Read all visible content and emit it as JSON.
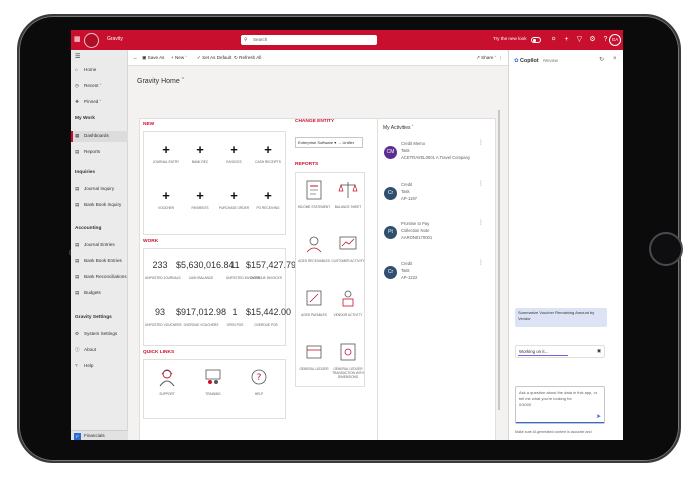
{
  "app": {
    "name": "Gravity",
    "search_placeholder": "Search",
    "try_new_look": "Try the new look",
    "avatar_initials": "GA",
    "brand_color": "#c8102e"
  },
  "topbar_icons": [
    "lightbulb-icon",
    "plus-icon",
    "filter-icon",
    "gear-icon",
    "help-icon"
  ],
  "sidebar": {
    "top_items": [
      {
        "label": "Home",
        "icon": "home-icon"
      },
      {
        "label": "Recent",
        "icon": "clock-icon"
      },
      {
        "label": "Pinned",
        "icon": "pin-icon"
      }
    ],
    "my_work": {
      "heading": "My Work",
      "items": [
        {
          "label": "Dashboards"
        },
        {
          "label": "Reports"
        }
      ]
    },
    "inquiries": {
      "heading": "Inquiries",
      "items": [
        {
          "label": "Journal Inquiry"
        },
        {
          "label": "Bank Book Inquiry"
        }
      ]
    },
    "accounting": {
      "heading": "Accounting",
      "items": [
        {
          "label": "Journal Entries"
        },
        {
          "label": "Bank Book Entries"
        },
        {
          "label": "Bank Reconciliations"
        },
        {
          "label": "Budgets"
        }
      ]
    },
    "gravity_settings": {
      "heading": "Gravity Settings",
      "items": [
        {
          "label": "System Settings"
        },
        {
          "label": "About"
        },
        {
          "label": "Help"
        }
      ]
    },
    "bottom": {
      "badge": "F",
      "label": "Financials"
    }
  },
  "commandbar": {
    "save_as": "Save As",
    "new": "New",
    "set_default": "Set As Default",
    "refresh": "Refresh All",
    "share": "Share"
  },
  "page": {
    "title": "Gravity Home"
  },
  "new_section": {
    "title": "NEW",
    "tiles": [
      "JOURNAL ENTRY",
      "BANK REC",
      "INVOICES",
      "CASH RECEIPTS",
      "VOUCHER",
      "PAYMENTS",
      "PURCHASE ORDER",
      "PO RECEIVING"
    ]
  },
  "work_section": {
    "title": "WORK",
    "metrics": [
      {
        "value": "233",
        "label": "UNPOSTED JOURNALS"
      },
      {
        "value": "$5,630,016.84",
        "label": "CASH BALANCE"
      },
      {
        "value": "11",
        "label": "UNPOSTED INVOICES"
      },
      {
        "value": "$157,427.79",
        "label": "OVERDUE INVOICES"
      },
      {
        "value": "93",
        "label": "UNPOSTED VOUCHERS"
      },
      {
        "value": "$917,012.98",
        "label": "OVERDUE VOUCHERS"
      },
      {
        "value": "1",
        "label": "OPEN POS"
      },
      {
        "value": "$15,442.00",
        "label": "OVERDUE POS"
      }
    ]
  },
  "quick_links": {
    "title": "QUICK LINKS",
    "items": [
      "SUPPORT",
      "TRAINING",
      "HELP"
    ]
  },
  "change_entity": {
    "title": "CHANGE ENTITY",
    "value": "Enterprise Software ▾ → Unifier"
  },
  "reports": {
    "title": "REPORTS",
    "items": [
      "INCOME STATEMENT",
      "BALANCE SHEET",
      "AGED RECEIVABLES",
      "CUSTOMER ACTIVITY",
      "AGED PAYABLES",
      "VENDOR ACTIVITY",
      "GENERAL LEDGER",
      "GENERAL LEDGER TRANSACTION WITH DIMENSIONS"
    ]
  },
  "activities": {
    "title": "My Activities",
    "items": [
      {
        "initials": "CM",
        "color": "#5c2d91",
        "line1": "Credit Memo",
        "line2": "Task",
        "line3": "ACETRAVEL0001 A Travel Company"
      },
      {
        "initials": "Cr",
        "color": "#2f4f6f",
        "line1": "Credit",
        "line2": "Task",
        "line3": "AP-1197"
      },
      {
        "initials": "Pt",
        "color": "#2f4f6f",
        "line1": "Promise to Pay",
        "line2": "Collection Note",
        "line3": "AARON0170001"
      },
      {
        "initials": "Cr",
        "color": "#2f4f6f",
        "line1": "Credit",
        "line2": "Task",
        "line3": "AP-1222"
      }
    ]
  },
  "copilot": {
    "title": "Copilot",
    "badge": "PREVIEW",
    "suggestion": "Summarize Voucher Remaining Amount by Vendor",
    "working": "Working on it...",
    "placeholder": "Ask a question about the data in this app, or tell me what you're looking for",
    "char_count": "0/4000",
    "disclaimer": "Make sure AI-generated content is accurate and"
  }
}
